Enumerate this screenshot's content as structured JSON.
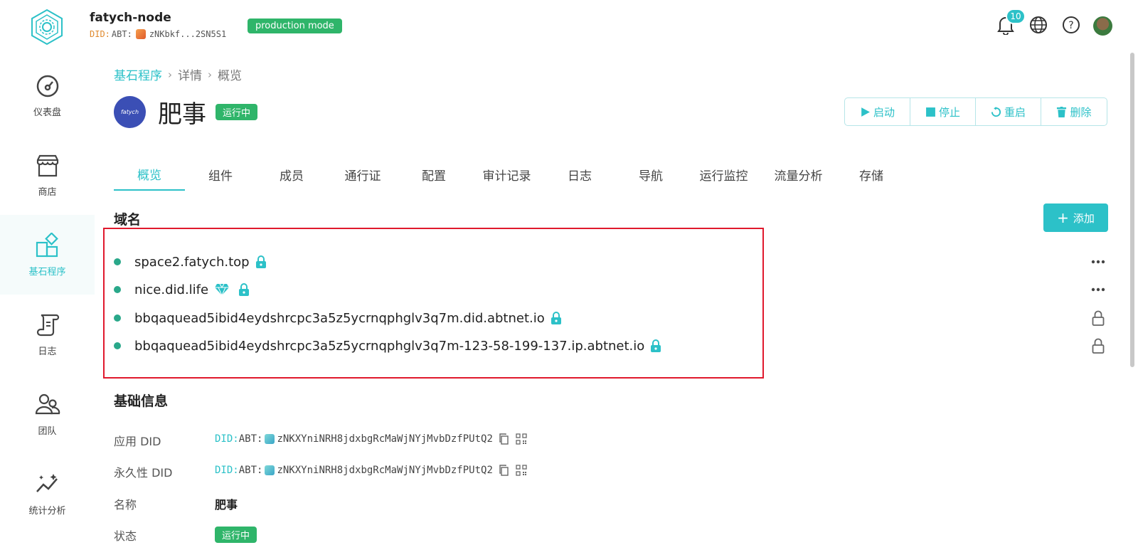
{
  "header": {
    "node_name": "fatych-node",
    "did_prefix": "DID:",
    "did_chain": "ABT:",
    "did_short": "zNKbkf...2SN5S1",
    "mode_badge": "production mode",
    "notification_count": "10",
    "icons": [
      "bell-icon",
      "globe-icon",
      "help-icon",
      "user-avatar"
    ]
  },
  "sidebar": {
    "items": [
      {
        "label": "仪表盘",
        "icon": "gauge-icon",
        "active": false
      },
      {
        "label": "商店",
        "icon": "store-icon",
        "active": false
      },
      {
        "label": "基石程序",
        "icon": "blocklet-icon",
        "active": true
      },
      {
        "label": "日志",
        "icon": "log-icon",
        "active": false
      },
      {
        "label": "团队",
        "icon": "team-icon",
        "active": false
      },
      {
        "label": "统计分析",
        "icon": "analytics-icon",
        "active": false
      }
    ]
  },
  "breadcrumb": {
    "root": "基石程序",
    "sep": "›",
    "detail": "详情",
    "current": "概览"
  },
  "app": {
    "avatar_text": "fatych",
    "title": "肥事",
    "status": "运行中"
  },
  "actions": {
    "start": "启动",
    "stop": "停止",
    "restart": "重启",
    "delete": "删除"
  },
  "tabs": [
    "概览",
    "组件",
    "成员",
    "通行证",
    "配置",
    "审计记录",
    "日志",
    "导航",
    "运行监控",
    "流量分析",
    "存储"
  ],
  "domains": {
    "title": "域名",
    "add_label": "添加",
    "items": [
      {
        "name": "space2.fatych.top",
        "diamond": false,
        "end": "more"
      },
      {
        "name": "nice.did.life",
        "diamond": true,
        "end": "more"
      },
      {
        "name": "bbqaquead5ibid4eydshrcpc3a5z5ycrnqphglv3q7m.did.abtnet.io",
        "diamond": false,
        "end": "lock"
      },
      {
        "name": "bbqaquead5ibid4eydshrcpc3a5z5ycrnqphglv3q7m-123-58-199-137.ip.abtnet.io",
        "diamond": false,
        "end": "lock"
      }
    ]
  },
  "basic_info": {
    "title": "基础信息",
    "app_did_label": "应用 DID",
    "perm_did_label": "永久性 DID",
    "name_label": "名称",
    "status_label": "状态",
    "did_prefix": "DID:",
    "did_chain": "ABT:",
    "app_did": "zNKXYniNRH8jdxbgRcMaWjNYjMvbDzfPUtQ2",
    "perm_did": "zNKXYniNRH8jdxbgRcMaWjNYjMvbDzfPUtQ2",
    "name": "肥事",
    "status": "运行中"
  },
  "colors": {
    "accent": "#2cc1c8",
    "success": "#2fb56a",
    "highlight": "#e0192d"
  }
}
